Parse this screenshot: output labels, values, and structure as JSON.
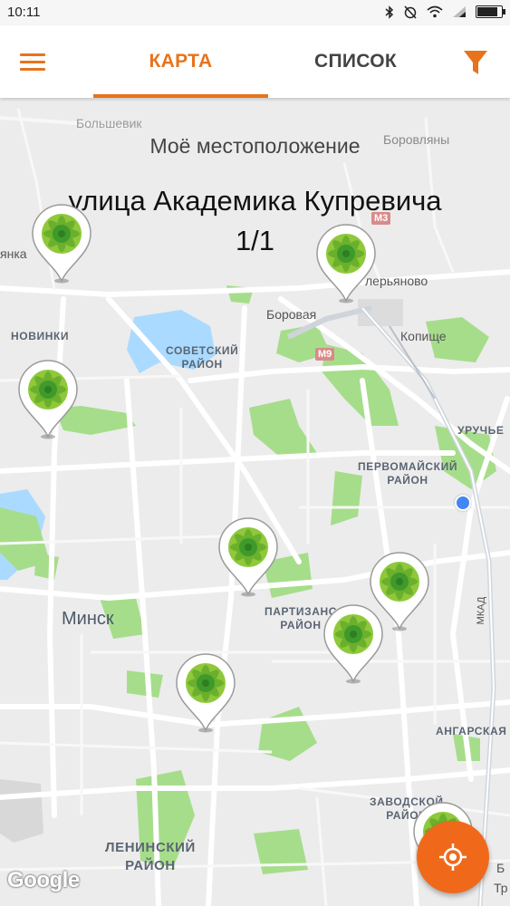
{
  "status_bar": {
    "time": "10:11",
    "icons": [
      "bluetooth-icon",
      "alarm-off-icon",
      "wifi-icon",
      "signal-icon",
      "battery-icon"
    ],
    "battery_level": 0.8
  },
  "app_bar": {
    "menu_icon": "hamburger-menu-icon",
    "tabs": [
      {
        "label": "КАРТА",
        "active": true
      },
      {
        "label": "СПИСОК",
        "active": false
      }
    ],
    "filter_icon": "filter-funnel-icon",
    "accent_color": "#e8731b"
  },
  "map": {
    "my_location_label": "Моё местоположение",
    "address_line1": "улица Академика Купревича",
    "address_line2": "1/1",
    "labels": {
      "novinki": "НОВИНКИ",
      "sovetsky": "СОВЕТСКИЙ\nРАЙОН",
      "pervomaisky": "ПЕРВОМАЙСКИЙ\nРАЙОН",
      "partizansky": "ПАРТИЗАНС\nРАЙОН",
      "uruchye": "УРУЧЬЕ",
      "angarskaya": "АНГАРСКАЯ",
      "zavodskoy": "ЗАВОДСКОЙ\nРАЙОН",
      "leninsky": "ЛЕНИНСКИЙ\nРАЙОН",
      "minsk": "Минск",
      "borovaya": "Боровая",
      "kopishche": "Копище",
      "valeryanovo": "лерьяново",
      "borovlyany": "Боровляны",
      "yanka": "янка",
      "bolshevik": "Большевик",
      "mkad": "МКАД",
      "m3": "M3",
      "m9": "M9",
      "edge_b": "Б",
      "edge_tr": "Тр"
    },
    "park_color": "#a6dd8a",
    "water_color": "#aadaff",
    "pin_icon": "green-flower-pin-icon",
    "pin_count": 8
  },
  "locate_button": {
    "icon": "crosshair-locate-icon",
    "color": "#f0691a"
  },
  "attribution": "Google"
}
